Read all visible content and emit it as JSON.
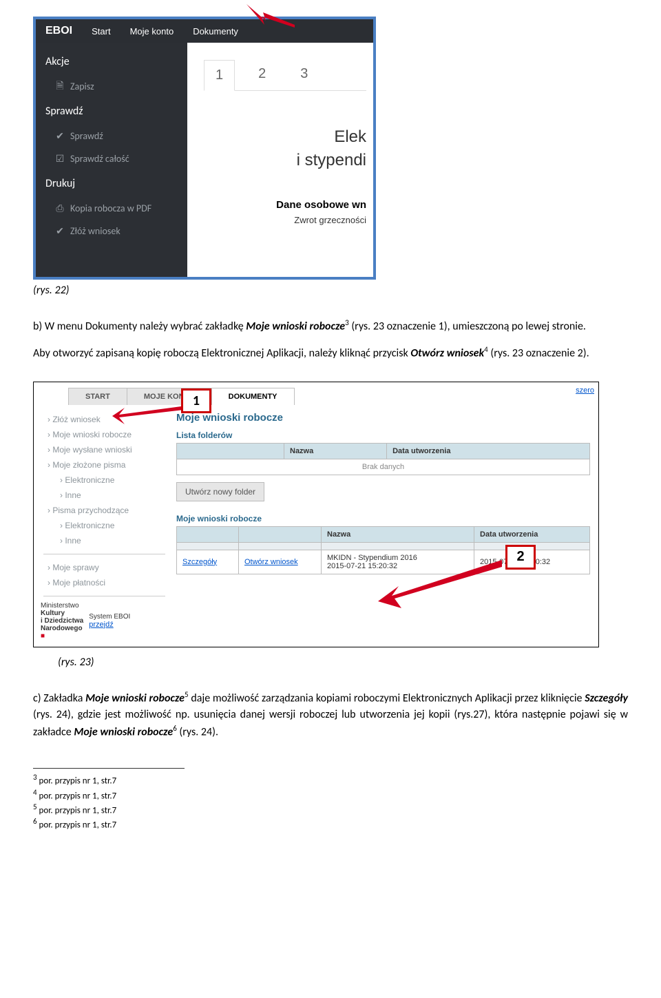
{
  "fig22": {
    "topnav": {
      "brand": "EBOI",
      "start": "Start",
      "moje": "Moje konto",
      "dok": "Dokumenty"
    },
    "sidebar": {
      "akcje": "Akcje",
      "zapisz": "Zapisz",
      "sprawdz": "Sprawdź",
      "sprawdzItem": "Sprawdź",
      "sprawdzCalosc": "Sprawdź całość",
      "drukuj": "Drukuj",
      "kopia": "Kopia robocza w PDF",
      "zloz": "Złóż wniosek"
    },
    "tabs": [
      "1",
      "2",
      "3"
    ],
    "big1": "Elek",
    "big2": "i stypendi",
    "bold": "Dane osobowe wn",
    "small": "Zwrot grzeczności"
  },
  "caption22": "(rys. 22)",
  "para_b_1": "b)  W menu Dokumenty należy wybrać zakładkę ",
  "para_b_bold": "Moje wnioski robocze",
  "para_b_sup": "3",
  "para_b_2": " (rys. 23 oznaczenie 1), umieszczoną po lewej stronie.",
  "para_b2_1": "Aby otworzyć zapisaną kopię roboczą Elektronicznej Aplikacji, należy kliknąć przycisk ",
  "para_b2_bold": "Otwórz wniosek",
  "para_b2_sup": "4",
  "para_b2_2": " (rys. 23 oznaczenie 2).",
  "fig23": {
    "tabs": {
      "start": "START",
      "moje": "MOJE KONTO",
      "dok": "DOKUMENTY"
    },
    "szero": "szero",
    "left": {
      "items": [
        "Złóż wniosek",
        "Moje wnioski robocze",
        "Moje wysłane wnioski",
        "Moje złożone pisma"
      ],
      "sub1": [
        "Elektroniczne",
        "Inne"
      ],
      "items2": [
        "Pisma przychodzące"
      ],
      "sub2": [
        "Elektroniczne",
        "Inne"
      ],
      "items3": [
        "Moje sprawy",
        "Moje płatności"
      ],
      "logo": {
        "l1": "Ministerstwo",
        "l2": "Kultury",
        "l3": "i Dziedzictwa",
        "l4": "Narodowego",
        "sys": "System EBOI",
        "link": "przejdź"
      }
    },
    "h2": "Moje wnioski robocze",
    "h3a": "Lista folderów",
    "th": {
      "nazwa": "Nazwa",
      "data": "Data utworzenia"
    },
    "brak": "Brak danych",
    "btn": "Utwórz nowy folder",
    "h3b": "Moje wnioski robocze",
    "rowLinks": {
      "szcz": "Szczegóły",
      "otw": "Otwórz wniosek"
    },
    "cell": {
      "name": "MKIDN - Stypendium 2016\n2015-07-21 15:20:32",
      "date": "2015-07-21 15:20:32"
    },
    "markers": {
      "one": "1",
      "two": "2"
    }
  },
  "caption23": "(rys. 23)",
  "para_c_1": "c)  Zakładka ",
  "para_c_b1": "Moje wnioski robocze",
  "para_c_s1": "5",
  "para_c_2": " daje możliwość zarządzania kopiami roboczymi Elektronicznych Aplikacji przez kliknięcie ",
  "para_c_b2": "Szczegóły",
  "para_c_3": " (rys. 24), gdzie jest możliwość np. usunięcia danej wersji roboczej lub utworzenia jej kopii (rys.27), która następnie pojawi się w zakładce ",
  "para_c_b3": "Moje wnioski robocze",
  "para_c_s2": "6",
  "para_c_4": " (rys. 24).",
  "footnotes": {
    "f3": {
      "n": "3",
      "t": " por. przypis nr 1, str.7"
    },
    "f4": {
      "n": "4",
      "t": " por. przypis nr 1, str.7"
    },
    "f5": {
      "n": "5",
      "t": " por. przypis nr 1, str.7"
    },
    "f6": {
      "n": "6",
      "t": " por. przypis nr 1, str.7"
    }
  }
}
